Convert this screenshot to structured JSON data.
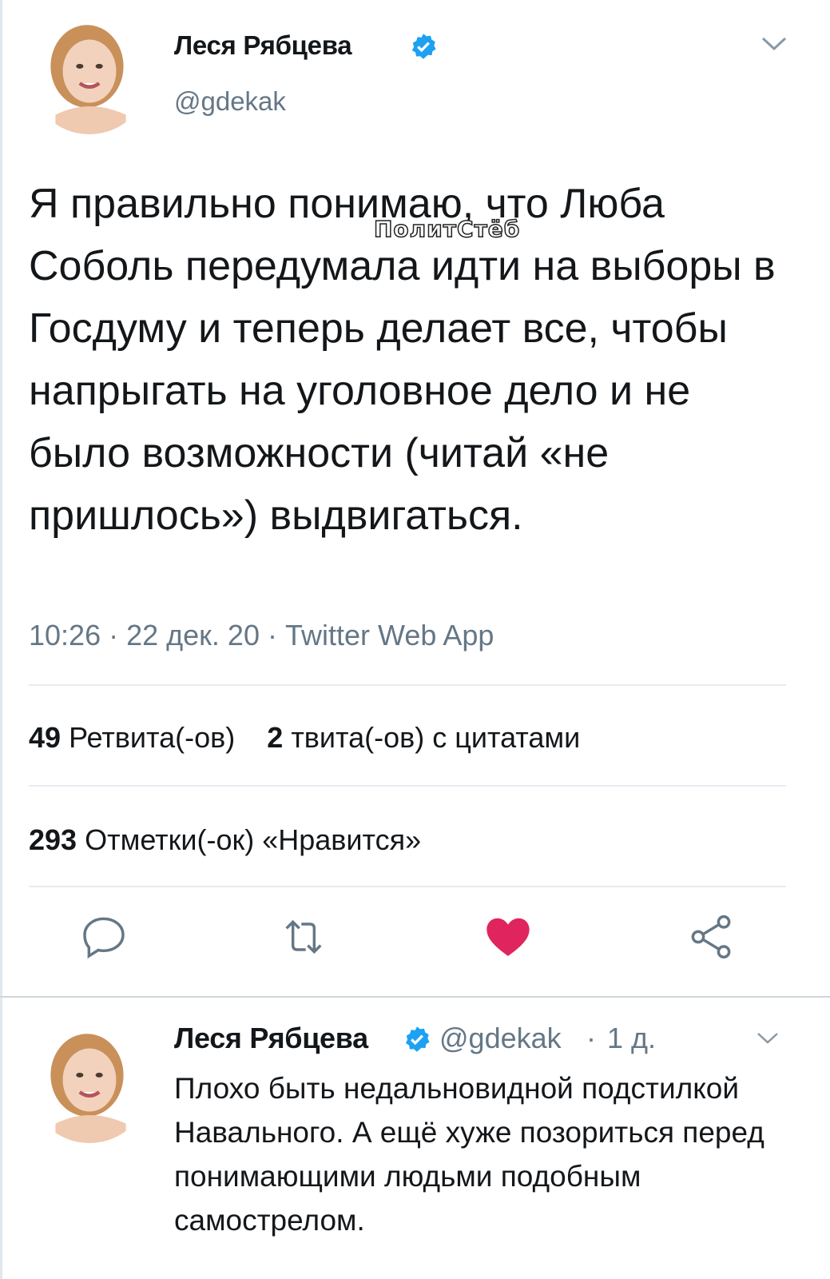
{
  "main_tweet": {
    "author_name": "Леся Рябцева",
    "author_handle": "@gdekak",
    "text": "Я правильно понимаю, что Люба Соболь передумала идти на выборы в Госдуму и теперь делает все, чтобы напрыгать на уголовное дело и не было возможности (читай «не пришлось») выдвигаться.",
    "watermark": "ПолитСтёб",
    "time": "10:26",
    "date": "22 дек. 20",
    "source": "Twitter Web App",
    "retweets_count": "49",
    "retweets_label": "Ретвита(-ов)",
    "quotes_count": "2",
    "quotes_label": "твита(-ов) с цитатами",
    "likes_count": "293",
    "likes_label": "Отметки(-ок) «Нравится»"
  },
  "reply_tweet": {
    "author_name": "Леся Рябцева",
    "author_handle": "@gdekak",
    "time_ago": "1 д.",
    "text": "Плохо быть недальновидной подстилкой Навального. А ещё хуже позориться перед понимающими людьми подобным самострелом."
  },
  "icons": {
    "verified": "verified-badge-icon",
    "reply": "speech-bubble-icon",
    "retweet": "retweet-arrows-icon",
    "like": "heart-icon",
    "share": "share-nodes-icon",
    "menu": "chevron-down-icon"
  },
  "colors": {
    "verified_blue": "#1da1f2",
    "like_red": "#e0245e",
    "muted_text": "#657786",
    "text": "#14171a"
  },
  "like_active": true
}
